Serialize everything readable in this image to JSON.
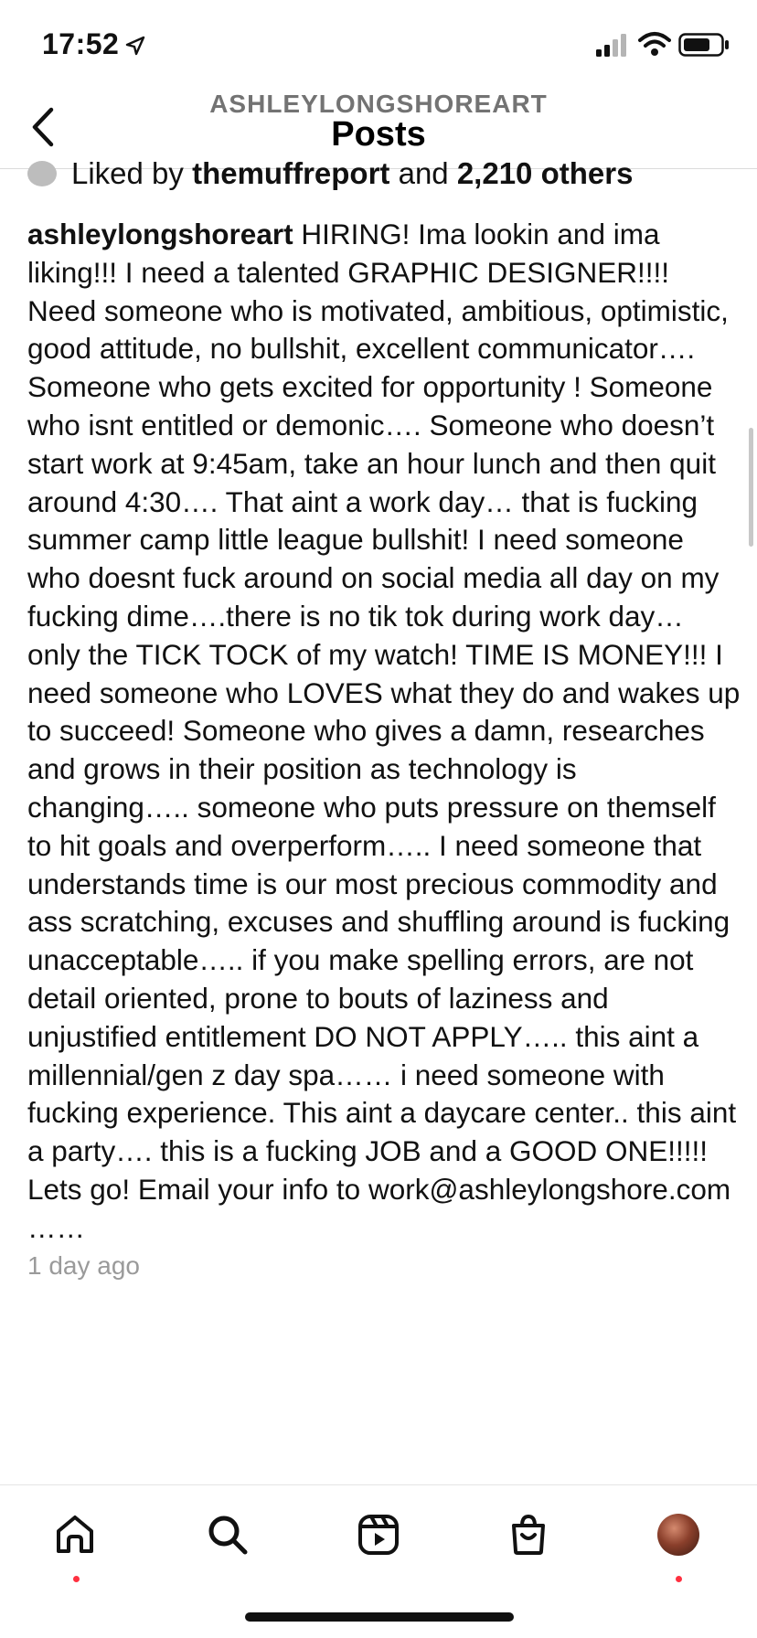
{
  "status_bar": {
    "time": "17:52"
  },
  "header": {
    "username": "ASHLEYLONGSHOREART",
    "title": "Posts"
  },
  "post": {
    "liked_by_prefix": "Liked by ",
    "liked_by_user": "themuffreport",
    "liked_by_middle": " and ",
    "liked_by_count": "2,210 others",
    "caption_username": "ashleylongshoreart",
    "caption_text": " HIRING! Ima lookin and ima liking!!! I need a talented GRAPHIC DESIGNER!!!! Need someone who is motivated, ambitious, optimistic, good attitude, no bullshit, excellent communicator…. Someone who gets excited for opportunity ! Someone who isnt entitled or demonic…. Someone who doesn’t start work at 9:45am, take an hour lunch and then quit around 4:30…. That aint a work day… that is fucking summer camp little league bullshit! I need someone who doesnt fuck around on social media all day on my fucking dime….there is no tik tok during work day… only the TICK TOCK of my watch!  TIME IS MONEY!!! I need someone who LOVES what they do and wakes up to succeed! Someone who gives a damn, researches and grows in their position as technology is changing….. someone who puts pressure on themself to hit goals and overperform….. I need someone that understands time is our most precious commodity and ass scratching, excuses and shuffling around is fucking unacceptable….. if you make spelling errors, are not detail oriented, prone to bouts of laziness and unjustified entitlement DO NOT APPLY….. this aint a millennial/gen z day spa…… i need someone with fucking experience. This aint a daycare center.. this aint a party…. this is a fucking JOB and a GOOD ONE!!!!! Lets go! Email your info to work@ashleylongshore.com ……",
    "timestamp": "1 day ago"
  },
  "bottom_nav": {
    "items": [
      {
        "icon": "home-icon",
        "badge": true
      },
      {
        "icon": "search-icon",
        "badge": false
      },
      {
        "icon": "reels-icon",
        "badge": false
      },
      {
        "icon": "shop-icon",
        "badge": false
      },
      {
        "icon": "profile-avatar",
        "badge": true
      }
    ],
    "badge_color": "#ff3040"
  }
}
